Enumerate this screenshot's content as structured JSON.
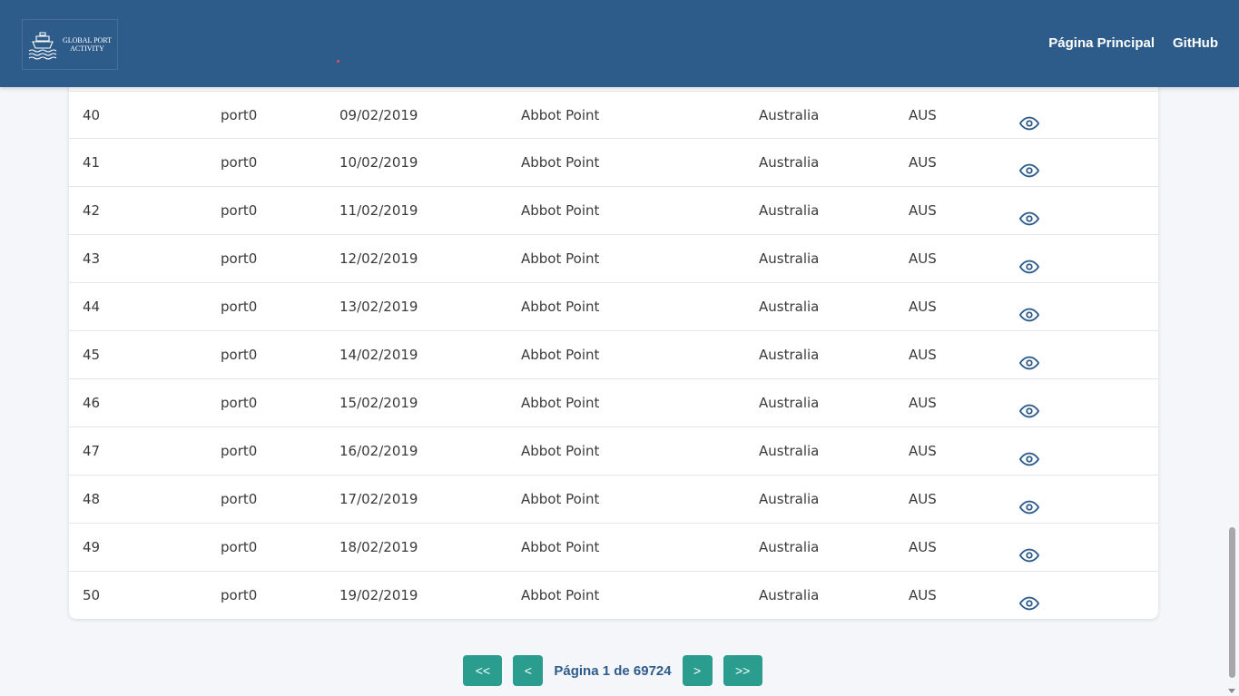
{
  "header": {
    "logo_line1": "GLOBAL PORT",
    "logo_line2": "ACTIVITY",
    "nav": [
      {
        "label": "Página Principal"
      },
      {
        "label": "GitHub"
      }
    ],
    "bg_color": "#2e5c8a"
  },
  "table": {
    "rows": [
      {
        "id": "40",
        "port": "port0",
        "date": "09/02/2019",
        "name": "Abbot Point",
        "country": "Australia",
        "iso": "AUS"
      },
      {
        "id": "41",
        "port": "port0",
        "date": "10/02/2019",
        "name": "Abbot Point",
        "country": "Australia",
        "iso": "AUS"
      },
      {
        "id": "42",
        "port": "port0",
        "date": "11/02/2019",
        "name": "Abbot Point",
        "country": "Australia",
        "iso": "AUS"
      },
      {
        "id": "43",
        "port": "port0",
        "date": "12/02/2019",
        "name": "Abbot Point",
        "country": "Australia",
        "iso": "AUS"
      },
      {
        "id": "44",
        "port": "port0",
        "date": "13/02/2019",
        "name": "Abbot Point",
        "country": "Australia",
        "iso": "AUS"
      },
      {
        "id": "45",
        "port": "port0",
        "date": "14/02/2019",
        "name": "Abbot Point",
        "country": "Australia",
        "iso": "AUS"
      },
      {
        "id": "46",
        "port": "port0",
        "date": "15/02/2019",
        "name": "Abbot Point",
        "country": "Australia",
        "iso": "AUS"
      },
      {
        "id": "47",
        "port": "port0",
        "date": "16/02/2019",
        "name": "Abbot Point",
        "country": "Australia",
        "iso": "AUS"
      },
      {
        "id": "48",
        "port": "port0",
        "date": "17/02/2019",
        "name": "Abbot Point",
        "country": "Australia",
        "iso": "AUS"
      },
      {
        "id": "49",
        "port": "port0",
        "date": "18/02/2019",
        "name": "Abbot Point",
        "country": "Australia",
        "iso": "AUS"
      },
      {
        "id": "50",
        "port": "port0",
        "date": "19/02/2019",
        "name": "Abbot Point",
        "country": "Australia",
        "iso": "AUS"
      }
    ],
    "row_action_icon": "eye-icon"
  },
  "pagination": {
    "first_label": "<<",
    "prev_label": "<",
    "info": "Página 1 de 69724",
    "next_label": ">",
    "last_label": ">>",
    "button_color": "#2a9d8f"
  }
}
